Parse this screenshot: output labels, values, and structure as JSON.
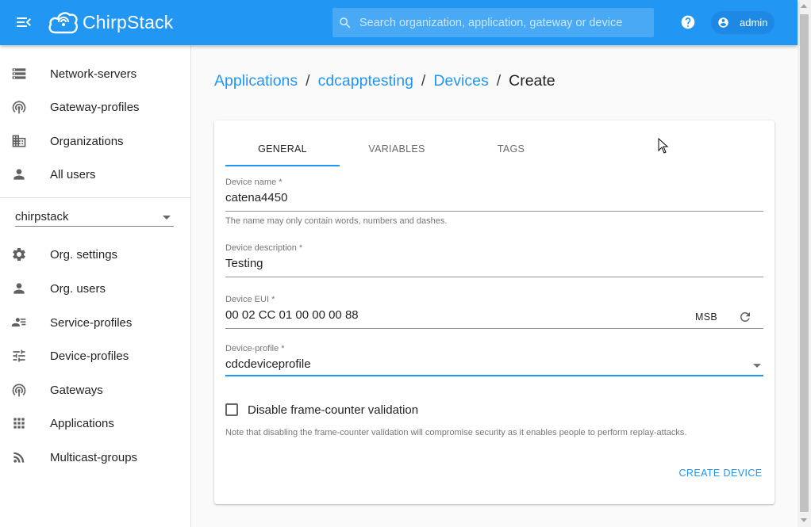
{
  "header": {
    "logo_text": "ChirpStack",
    "search_placeholder": "Search organization, application, gateway or device",
    "user_name": "admin",
    "bar_color": "#2196f3"
  },
  "sidebar": {
    "top_items": [
      {
        "label": "Network-servers",
        "icon": "server-icon"
      },
      {
        "label": "Gateway-profiles",
        "icon": "antenna-icon"
      },
      {
        "label": "Organizations",
        "icon": "building-icon"
      },
      {
        "label": "All users",
        "icon": "person-icon"
      }
    ],
    "org_select_value": "chirpstack",
    "org_items": [
      {
        "label": "Org. settings",
        "icon": "gear-icon"
      },
      {
        "label": "Org. users",
        "icon": "person-icon"
      },
      {
        "label": "Service-profiles",
        "icon": "account-list-icon"
      },
      {
        "label": "Device-profiles",
        "icon": "tune-icon"
      },
      {
        "label": "Gateways",
        "icon": "antenna-icon"
      },
      {
        "label": "Applications",
        "icon": "apps-grid-icon"
      },
      {
        "label": "Multicast-groups",
        "icon": "rss-icon"
      }
    ]
  },
  "breadcrumb": {
    "items": [
      "Applications",
      "cdcapptesting",
      "Devices"
    ],
    "current": "Create",
    "separator": "/"
  },
  "tabs": [
    "GENERAL",
    "VARIABLES",
    "TAGS"
  ],
  "active_tab": "GENERAL",
  "form": {
    "device_name": {
      "label": "Device name *",
      "value": "catena4450",
      "helper": "The name may only contain words, numbers and dashes."
    },
    "device_description": {
      "label": "Device description *",
      "value": "Testing"
    },
    "device_eui": {
      "label": "Device EUI *",
      "value": "00 02 CC 01 00 00 00 88",
      "byte_order": "MSB"
    },
    "device_profile": {
      "label": "Device-profile *",
      "value": "cdcdeviceprofile"
    },
    "disable_fcnt": {
      "label": "Disable frame-counter validation",
      "checked": false
    },
    "note": "Note that disabling the frame-counter validation will compromise security as it enables people to perform replay-attacks.",
    "submit_label": "CREATE DEVICE"
  },
  "accent_color": "#2196f3"
}
